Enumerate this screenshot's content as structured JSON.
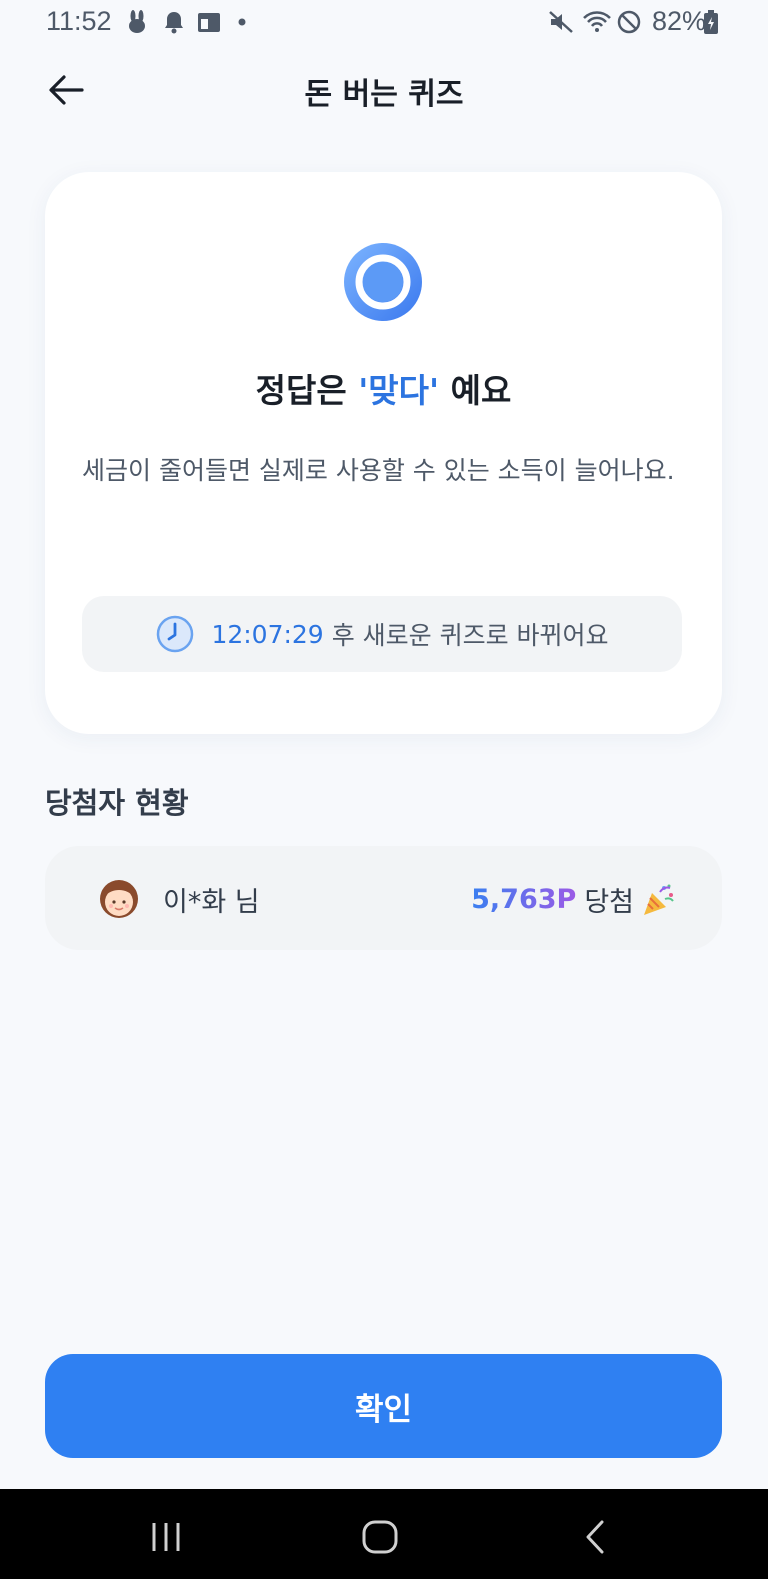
{
  "status": {
    "time": "11:52",
    "battery": "82%",
    "icons": [
      "rabbit-icon",
      "bell-icon",
      "gallery-icon",
      "dot-icon",
      "mute-icon",
      "wifi-icon",
      "block-icon",
      "battery-icon"
    ]
  },
  "header": {
    "title": "돈 버는 퀴즈",
    "back_icon": "back-arrow-icon"
  },
  "card": {
    "answer_prefix": "정답은 ",
    "answer_value": "'맞다'",
    "answer_suffix": " 예요",
    "explanation": "세금이 줄어들면 실제로 사용할 수 있는 소득이 늘어나요.",
    "timer_time": "12:07:29",
    "timer_text": "후 새로운 퀴즈로 바뀌어요"
  },
  "winners": {
    "title": "당첨자 현황",
    "items": [
      {
        "name": "이*화 님",
        "amount": "5,763P",
        "label": "당첨"
      }
    ]
  },
  "confirm_label": "확인",
  "colors": {
    "accent": "#2f80f2",
    "highlight": "#2c74e0",
    "background": "#f7f9fc"
  }
}
